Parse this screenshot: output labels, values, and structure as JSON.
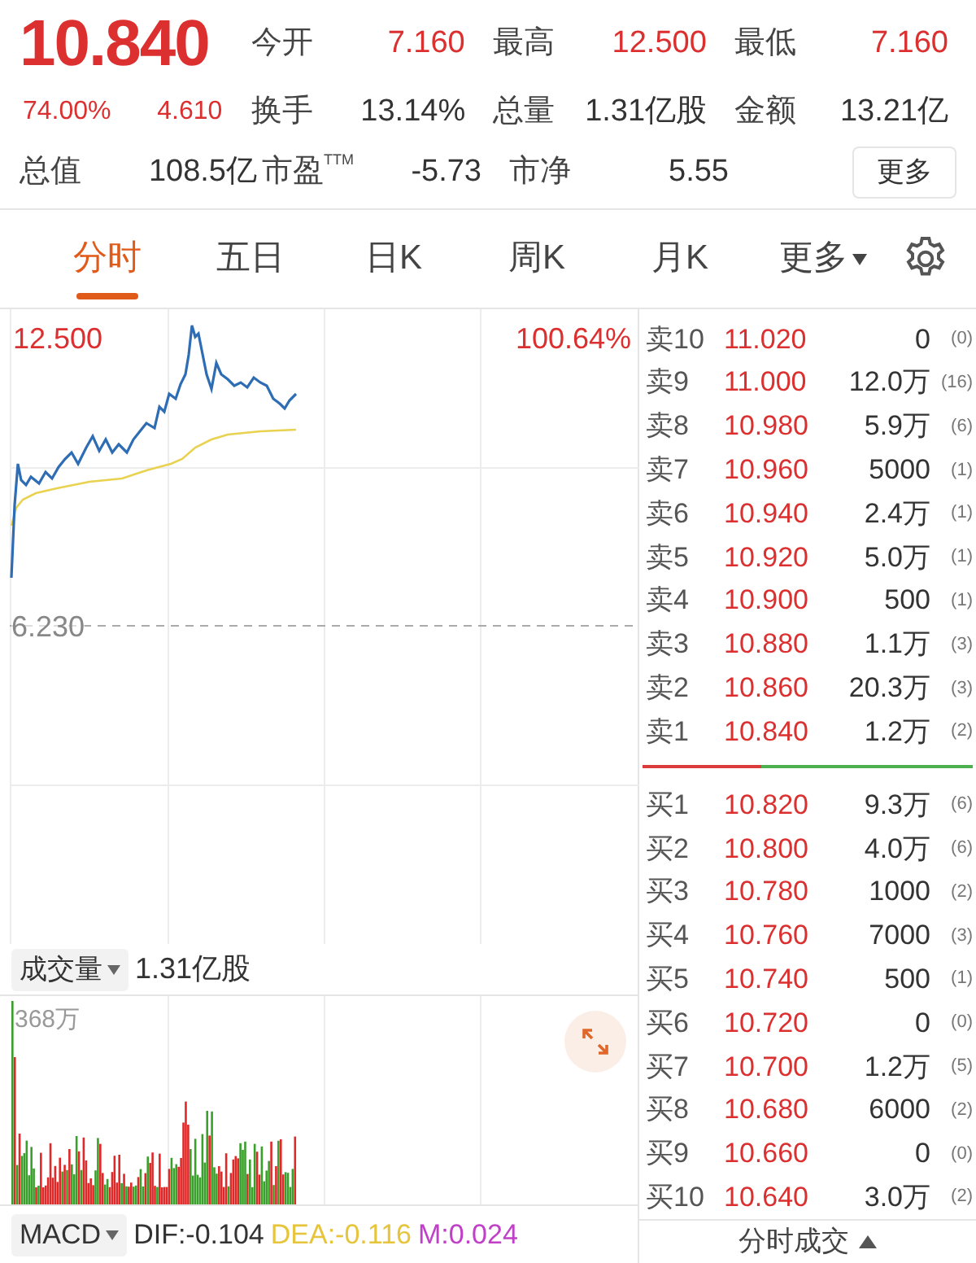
{
  "quote": {
    "rows": [
      [
        {
          "value": "10.840",
          "kind": "price"
        },
        {
          "label": "今开",
          "value": "7.160",
          "kind": "up"
        },
        {
          "label": "最高",
          "value": "12.500",
          "kind": "up"
        },
        {
          "label": "最低",
          "value": "7.160",
          "kind": "up"
        }
      ],
      [
        {
          "label": "74.00%",
          "value": "4.610",
          "kind": "change"
        },
        {
          "label": "换手",
          "value": "13.14%",
          "kind": "plain"
        },
        {
          "label": "总量",
          "value": "1.31亿股",
          "kind": "plain"
        },
        {
          "label": "金额",
          "value": "13.21亿",
          "kind": "plain"
        }
      ],
      [
        {
          "label": "总值",
          "value": "108.5亿",
          "kind": "plain"
        },
        {
          "label": "市盈$^{TTM}$",
          "value": "-5.73",
          "kind": "plain"
        },
        {
          "label": "市净",
          "value": "5.55",
          "kind": "plain"
        }
      ]
    ],
    "more_button": "更多"
  },
  "tabs": [
    {
      "label": "分时",
      "selected": true,
      "kind": "tab"
    },
    {
      "label": "五日",
      "selected": false,
      "kind": "tab"
    },
    {
      "label": "日K",
      "selected": false,
      "kind": "tab"
    },
    {
      "label": "周K",
      "selected": false,
      "kind": "tab"
    },
    {
      "label": "月K",
      "selected": false,
      "kind": "tab"
    },
    {
      "label": "更多",
      "selected": false,
      "kind": "dropdown"
    }
  ],
  "chart": {
    "high_label": "12.500",
    "pct_label": "100.64%",
    "base_label": "6.230"
  },
  "volume": {
    "selector": "成交量",
    "total": "1.31亿股",
    "max_label": "368万"
  },
  "macd": {
    "selector": "MACD",
    "values": [
      {
        "text": "DIF:-0.104",
        "color": "#333333"
      },
      {
        "text": "DEA:-0.116",
        "color": "#e6c43c"
      },
      {
        "text": "M:0.024",
        "color": "#c040c8"
      }
    ]
  },
  "order_book": {
    "asks": [
      {
        "label": "卖10",
        "price": "11.020",
        "volume": "0",
        "count": "(0)"
      },
      {
        "label": "卖9",
        "price": "11.000",
        "volume": "12.0万",
        "count": "(16)"
      },
      {
        "label": "卖8",
        "price": "10.980",
        "volume": "5.9万",
        "count": "(6)"
      },
      {
        "label": "卖7",
        "price": "10.960",
        "volume": "5000",
        "count": "(1)"
      },
      {
        "label": "卖6",
        "price": "10.940",
        "volume": "2.4万",
        "count": "(1)"
      },
      {
        "label": "卖5",
        "price": "10.920",
        "volume": "5.0万",
        "count": "(1)"
      },
      {
        "label": "卖4",
        "price": "10.900",
        "volume": "500",
        "count": "(1)"
      },
      {
        "label": "卖3",
        "price": "10.880",
        "volume": "1.1万",
        "count": "(3)"
      },
      {
        "label": "卖2",
        "price": "10.860",
        "volume": "20.3万",
        "count": "(3)"
      },
      {
        "label": "卖1",
        "price": "10.840",
        "volume": "1.2万",
        "count": "(2)"
      }
    ],
    "balance": {
      "level": 0.36
    },
    "bids": [
      {
        "label": "买1",
        "price": "10.820",
        "volume": "9.3万",
        "count": "(6)"
      },
      {
        "label": "买2",
        "price": "10.800",
        "volume": "4.0万",
        "count": "(6)"
      },
      {
        "label": "买3",
        "price": "10.780",
        "volume": "1000",
        "count": "(2)"
      },
      {
        "label": "买4",
        "price": "10.760",
        "volume": "7000",
        "count": "(3)"
      },
      {
        "label": "买5",
        "price": "10.740",
        "volume": "500",
        "count": "(1)"
      },
      {
        "label": "买6",
        "price": "10.720",
        "volume": "0",
        "count": "(0)"
      },
      {
        "label": "买7",
        "price": "10.700",
        "volume": "1.2万",
        "count": "(5)"
      },
      {
        "label": "买8",
        "price": "10.680",
        "volume": "6000",
        "count": "(2)"
      },
      {
        "label": "买9",
        "price": "10.660",
        "volume": "0",
        "count": "(0)"
      },
      {
        "label": "买10",
        "price": "10.640",
        "volume": "3.0万",
        "count": "(2)"
      }
    ],
    "trades_button": "分时成交"
  }
}
